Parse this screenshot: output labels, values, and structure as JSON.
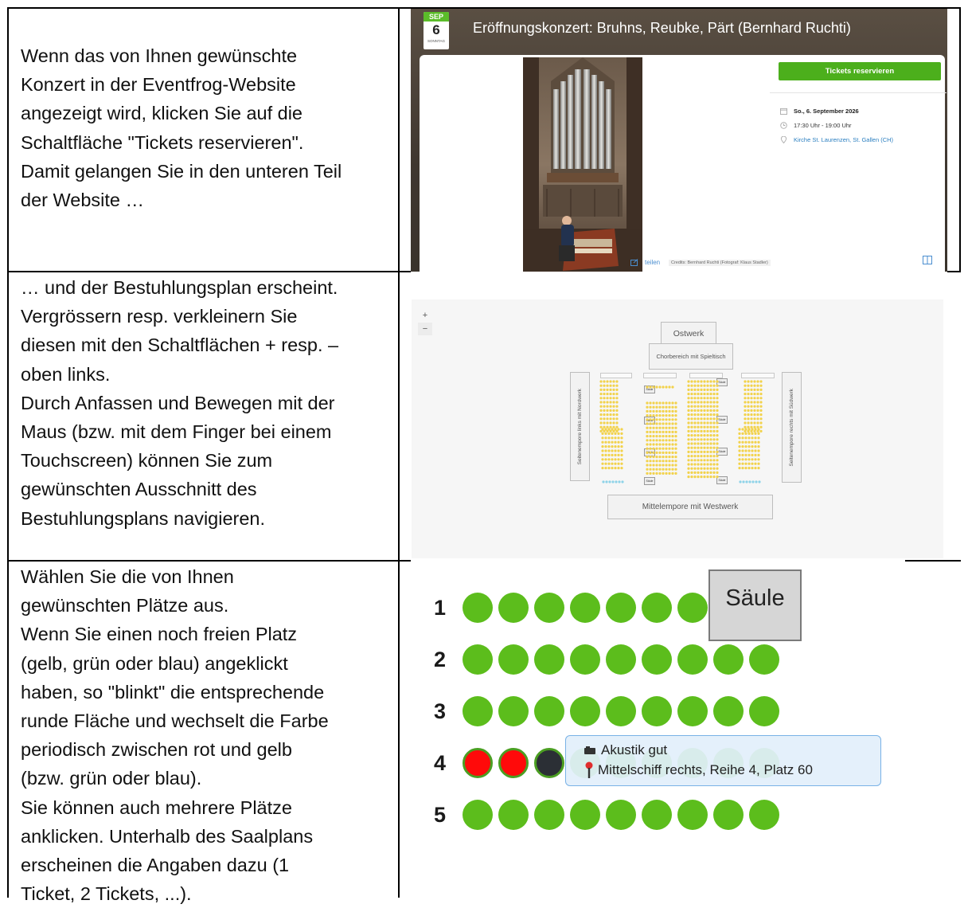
{
  "rows": [
    {
      "text": [
        "Wenn das von Ihnen gewünschte",
        "Konzert in der Eventfrog-Website",
        "angezeigt wird, klicken Sie auf die",
        "Schaltfläche \"Tickets reservieren\".",
        "Damit gelangen Sie in den unteren Teil",
        "der Website …"
      ]
    },
    {
      "text": [
        "… und der Bestuhlungsplan erscheint.",
        "Vergrössern resp. verkleinern Sie",
        "diesen mit den Schaltflächen + resp. –",
        "oben links.",
        "Durch Anfassen und Bewegen mit der",
        "Maus (bzw. mit dem Finger bei einem",
        "Touchscreen) können Sie zum",
        "gewünschten Ausschnitt des",
        "Bestuhlungsplans navigieren."
      ]
    },
    {
      "text": [
        "Wählen Sie die von Ihnen",
        "gewünschten Plätze aus.",
        "Wenn Sie einen noch freien Platz",
        "(gelb, grün oder blau) angeklickt",
        "haben, so \"blinkt\" die entsprechende",
        "runde Fläche und wechselt die Farbe",
        "periodisch zwischen rot und gelb",
        "(bzw. grün oder blau).",
        "Sie können auch mehrere Plätze",
        "anklicken. Unterhalb des Saalplans",
        "erscheinen die Angaben dazu (1",
        "Ticket, 2 Tickets, ...)."
      ]
    }
  ],
  "event": {
    "month": "SEP",
    "day": "6",
    "weekday": "SONNTAG",
    "title": "Eröffnungskonzert: Bruhns, Reubke, Pärt (Bernhard Ruchti)",
    "ticket_button": "Tickets reservieren",
    "date": "So., 6. September 2026",
    "time": "17:30 Uhr - 19:00 Uhr",
    "location": "Kirche St. Laurenzen, St. Gallen (CH)",
    "credits": "Credits: Bernhard Ruchti (Fotograf: Klaus Stadler)",
    "share": "teilen",
    "colors": {
      "accent": "#4caf1c",
      "link": "#2b7fc0"
    }
  },
  "plan": {
    "zoom_in": "+",
    "zoom_out": "−",
    "ostwerk": "Ostwerk",
    "chor": "Chorbereich mit Spieltisch",
    "left_gallery": "Seitenempore links mit Nordwerk",
    "right_gallery": "Seitenempore rechts mit Südwerk",
    "west": "Mittelempore mit Westwerk",
    "pillar_mini": "Säule",
    "colors": {
      "free_yellow": "#f2d24b",
      "free_blue": "#8fd3e8"
    }
  },
  "zoom": {
    "rows": [
      "1",
      "2",
      "3",
      "4",
      "5"
    ],
    "seats_per_row": [
      7,
      9,
      9,
      9,
      9
    ],
    "pillar": "Säule",
    "tooltip_line1": "Akustik gut",
    "tooltip_line2": "Mittelschiff rechts, Reihe 4, Platz 60",
    "colors": {
      "free": "#5cbd1c",
      "selected": "#ff0a0a",
      "dark": "#2b2f35"
    }
  }
}
